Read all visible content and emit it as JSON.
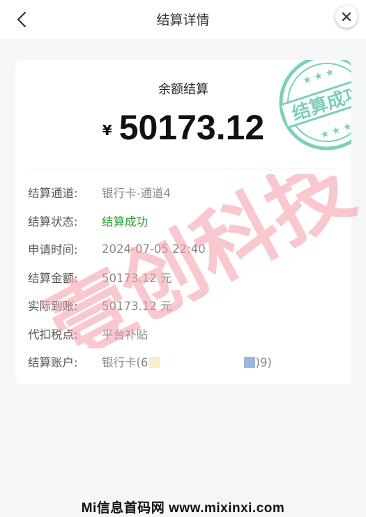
{
  "header": {
    "title": "结算详情"
  },
  "card": {
    "label": "余额结算",
    "currency_symbol": "¥",
    "amount": "50173.12",
    "stamp_text": "结算成功",
    "rows": [
      {
        "label": "结算通道:",
        "value": "银行卡-通道4"
      },
      {
        "label": "结算状态:",
        "value": "结算成功"
      },
      {
        "label": "申请时间:",
        "value": "2024-07-05 22:40"
      },
      {
        "label": "结算金额:",
        "value": "50173.12 元"
      },
      {
        "label": "实际到账:",
        "value": "50173.12 元"
      },
      {
        "label": "代扣税点:",
        "value": "平台补贴"
      },
      {
        "label": "结算账户:",
        "value_prefix": "银行卡(6",
        "value_suffix": ")9)"
      }
    ]
  },
  "watermark": {
    "text": "壹创科技"
  },
  "footer": {
    "text": "Mi信息首码网 www.mixinxi.com"
  },
  "colors": {
    "success": "#2e9e35",
    "stamp": "#4fc1a0",
    "watermark": "#f39aa6"
  }
}
